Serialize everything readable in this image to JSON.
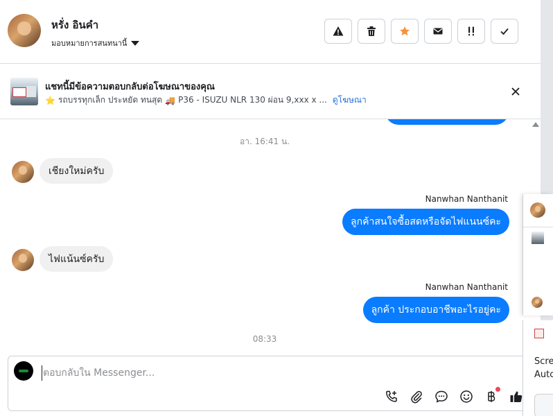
{
  "contact": {
    "name": "หรั่ง อินคำ",
    "assign_label": "มอบหมายการสนทนานี้"
  },
  "toolbar": {
    "items": [
      {
        "name": "report",
        "icon": "warning-icon"
      },
      {
        "name": "delete",
        "icon": "trash-icon"
      },
      {
        "name": "star",
        "icon": "star-icon"
      },
      {
        "name": "email",
        "icon": "envelope-icon"
      },
      {
        "name": "priority",
        "icon": "double-exclamation-icon"
      },
      {
        "name": "done",
        "icon": "checkmark-icon"
      }
    ],
    "star_color": "#f7923b"
  },
  "ad_banner": {
    "title": "แชทนี้มีข้อความตอบกลับต่อโฆษณาของคุณ",
    "subtitle": "รถบรรทุกเล็ก ประหยัด ทนสุด",
    "subtitle_extra": "P36 - ISUZU NLR 130 ผ่อน 9,xxx x ...",
    "link": "ดูโฆษณา"
  },
  "thread": {
    "timestamp_1": "อา. 16:41 น.",
    "messages": [
      {
        "direction": "in",
        "text": "เชียงใหม่ครับ"
      },
      {
        "direction": "out",
        "sender": "Nanwhan Nanthanit",
        "text": "ลูกค้าสนใจซื้อสดหรือจัดไฟแนนซ์คะ"
      },
      {
        "direction": "in",
        "text": "ไฟแน้นซ์ครับ"
      },
      {
        "direction": "out",
        "sender": "Nanwhan Nanthanit",
        "text": "ลูกค้า ประกอบอาชีพอะไรอยู่คะ"
      }
    ],
    "timestamp_2": "08:33"
  },
  "composer": {
    "placeholder": "ตอบกลับใน Messenger...",
    "tools": [
      "phone-plus-icon",
      "paperclip-icon",
      "chat-bubble-icon",
      "smiley-icon",
      "baht-icon",
      "thumbs-up-icon"
    ]
  },
  "overlay": {
    "text_line1": "Scre",
    "text_line2": "Auto"
  },
  "colors": {
    "accent": "#0a7cff",
    "link": "#216fdb",
    "incoming_bubble": "#f0f0f0",
    "notification_dot": "#f3425f"
  }
}
